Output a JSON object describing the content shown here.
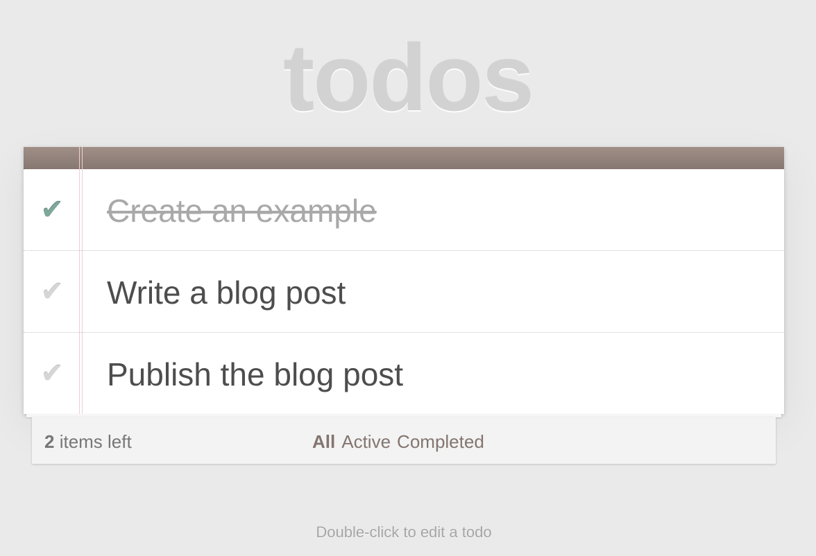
{
  "app": {
    "title": "todos"
  },
  "todos": [
    {
      "label": "Create an example",
      "completed": true,
      "check_glyph": "✔"
    },
    {
      "label": "Write a blog post",
      "completed": false,
      "check_glyph": "✔"
    },
    {
      "label": "Publish the blog post",
      "completed": false,
      "check_glyph": "✔"
    }
  ],
  "footer": {
    "count": "2",
    "count_suffix": " items left",
    "filters": {
      "all": "All",
      "active": "Active",
      "completed": "Completed"
    },
    "selected_filter": "all"
  },
  "info": {
    "hint": "Double-click to edit a todo"
  },
  "colors": {
    "background": "#eaeaea",
    "header_bar": "#877872",
    "check_done": "#7fa79b",
    "check_undone": "#d6d6d6",
    "filter_link": "#83756f"
  },
  "icons": {
    "toggle": "check-mark-icon"
  }
}
